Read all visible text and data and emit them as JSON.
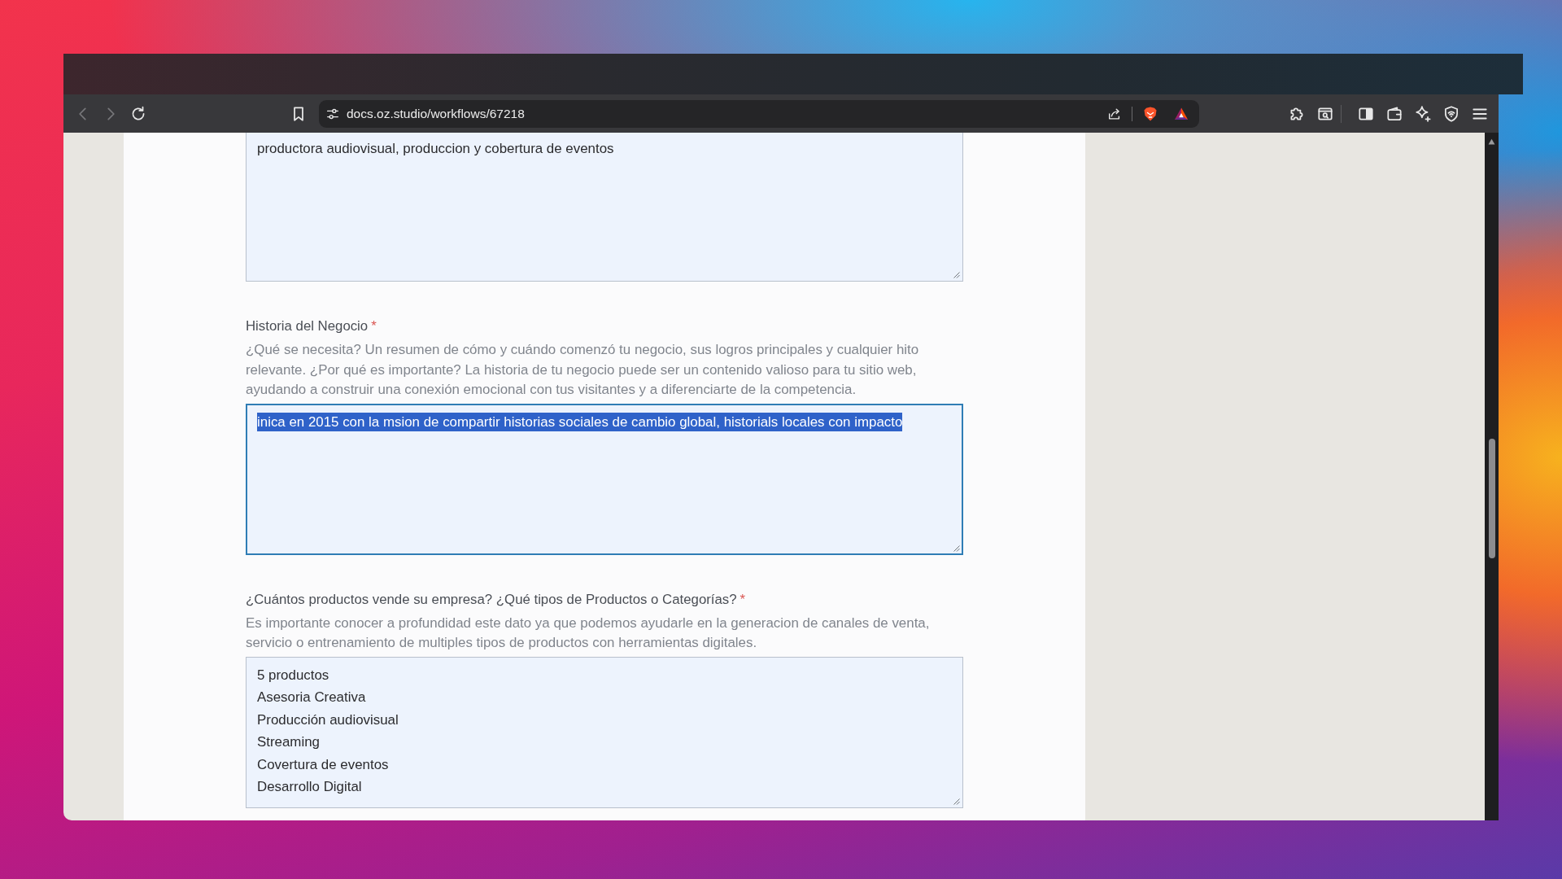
{
  "browser": {
    "back_button": {
      "disabled": true
    },
    "forward_button": {
      "disabled": true
    },
    "address_bar": {
      "url": "docs.oz.studio/workflows/67218"
    }
  },
  "form": {
    "fields": [
      {
        "lines": [
          "productora audiovisual, produccion y cobertura de eventos"
        ],
        "focused": false,
        "text_selected": false
      },
      {
        "label": "Historia del Negocio",
        "required_mark": "*",
        "description": "¿Qué se necesita? Un resumen de cómo y cuándo comenzó tu negocio, sus logros principales y cualquier hito relevante. ¿Por qué es importante? La historia de tu negocio puede ser un contenido valioso para tu sitio web, ayudando a construir una conexión emocional con tus visitantes y a diferenciarte de la competencia.",
        "lines": [
          "inica en 2015 con la msion de compartir historias sociales de cambio global, historials locales con impacto"
        ],
        "focused": true,
        "text_selected": true
      },
      {
        "label": "¿Cuántos productos vende su empresa? ¿Qué tipos de Productos o Categorías?",
        "required_mark": "*",
        "description": "Es importante conocer a profundidad este dato ya que podemos ayudarle en la generacion de canales de venta, servicio o entrenamiento de multiples tipos de productos con herramientas digitales.",
        "lines": [
          "5 productos",
          "Asesoria Creativa",
          "Producción audiovisual",
          "Streaming",
          "Covertura de eventos",
          "Desarrollo Digital"
        ],
        "focused": false,
        "text_selected": false
      }
    ]
  }
}
